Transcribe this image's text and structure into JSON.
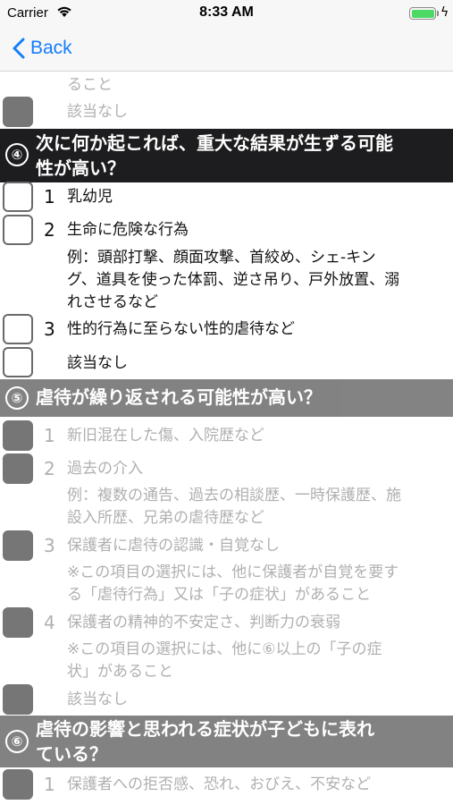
{
  "status_bar": {
    "carrier": "Carrier",
    "time": "8:33 AM",
    "battery_level": 1.0,
    "battery_color": "#4cd964"
  },
  "nav": {
    "back_label": "Back",
    "accent_color": "#147efb"
  },
  "section3_tail": {
    "text_tail": "ること",
    "none_label": "該当なし"
  },
  "section4": {
    "number": "④",
    "title_line1": "次に何か起これば、重大な結果が生ずる可能",
    "title_line2": "性が高い？",
    "items": [
      {
        "num": "1",
        "label": "乳幼児"
      },
      {
        "num": "2",
        "label": "生命に危険な行為",
        "note_lines": [
          "例：頭部打撃、顔面攻撃、首絞め、シェ-キン",
          "グ、道具を使った体罰、逆さ吊り、戸外放置、溺",
          "れさせるなど"
        ]
      },
      {
        "num": "3",
        "label": "性的行為に至らない性的虐待など"
      }
    ],
    "none_label": "該当なし"
  },
  "section5": {
    "number": "⑤",
    "title": "虐待が繰り返される可能性が高い？",
    "items": [
      {
        "num": "1",
        "label": "新旧混在した傷、入院歴など"
      },
      {
        "num": "2",
        "label": "過去の介入",
        "note_lines": [
          "例：複数の通告、過去の相談歴、一時保護歴、施",
          "設入所歴、兄弟の虐待歴など"
        ]
      },
      {
        "num": "3",
        "label": "保護者に虐待の認識・自覚なし",
        "note_lines": [
          "※この項目の選択には、他に保護者が自覚を要す",
          "る「虐待行為」又は「子の症状」があること"
        ]
      },
      {
        "num": "4",
        "label": "保護者の精神的不安定さ、判断力の衰弱",
        "note_lines": [
          "※この項目の選択には、他に⑥以上の「子の症",
          "状」があること"
        ]
      }
    ],
    "none_label": "該当なし"
  },
  "section6": {
    "number": "⑥",
    "title_line1": "虐待の影響と思われる症状が子どもに表れ",
    "title_line2": "ている？",
    "items": [
      {
        "num": "1",
        "label": "保護者への拒否感、恐れ、おびえ、不安など"
      }
    ]
  }
}
